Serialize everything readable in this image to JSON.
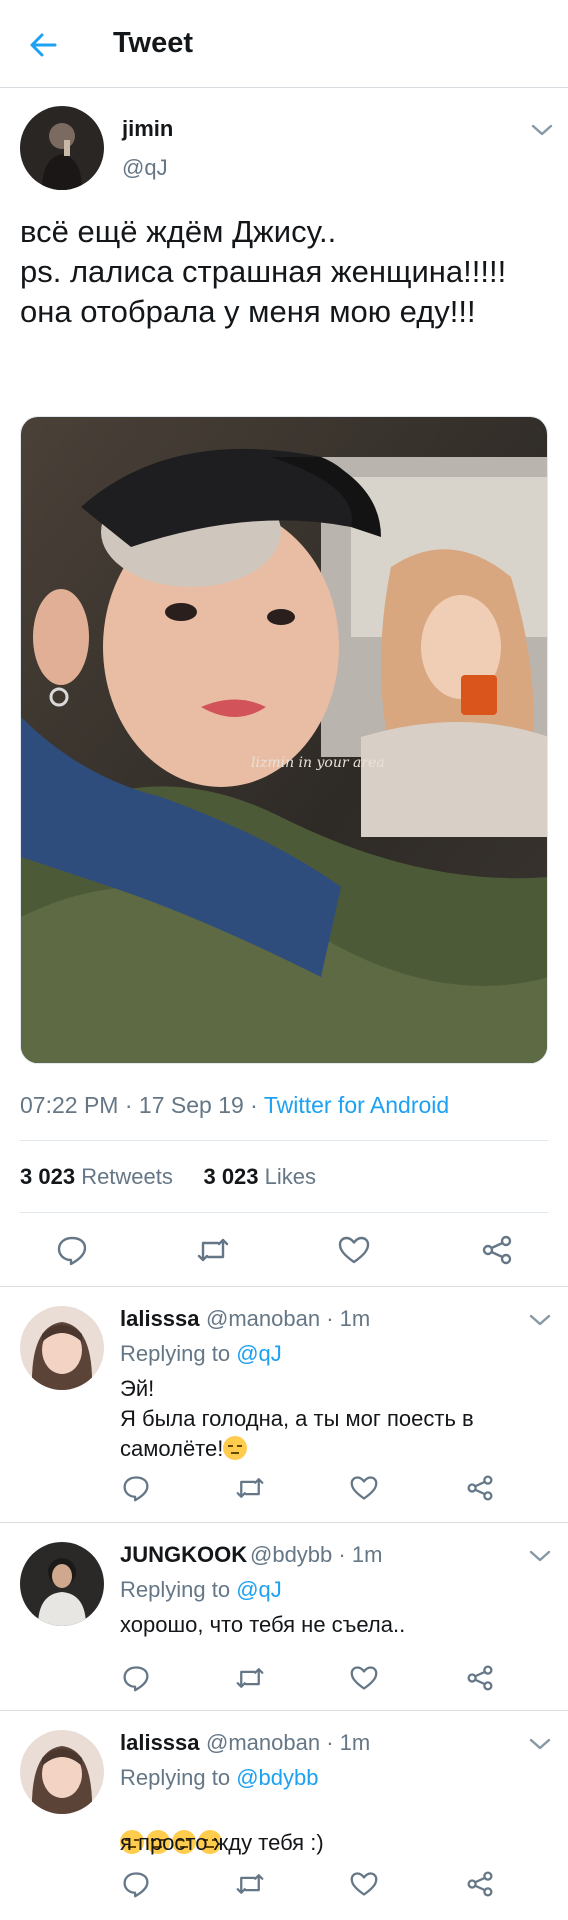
{
  "header": {
    "title": "Tweet"
  },
  "tweet": {
    "author_name": "jimin",
    "author_handle": "@qJ",
    "text": "всё ещё ждём Джису..\nps. лалиса страшная женщина!!!!!\nона отобрала у меня мою еду!!!",
    "photo_watermark": "lizmin in your area",
    "time": "07:22 PM",
    "date": "17 Sep 19",
    "separator": " · ",
    "client": "Twitter for Android",
    "retweets_count": "3 023",
    "retweets_label": "Retweets",
    "likes_count": "3 023",
    "likes_label": "Likes"
  },
  "replies": [
    {
      "name": "lalisssa",
      "handle": "@manoban",
      "time": "1m",
      "replying_label": "Replying to ",
      "replying_to": "@qJ",
      "text": "Эй!\nЯ была голодна, а ты мог поесть в самолёте!",
      "emoji": "unamused-face-emoji"
    },
    {
      "name": "JUNGKOOK",
      "handle": "@bdybb",
      "time": "1m",
      "replying_label": "Replying to ",
      "replying_to": "@qJ",
      "text": "хорошо, что тебя не съела.."
    },
    {
      "name": "lalisssa",
      "handle": "@manoban",
      "time": "1m",
      "replying_label": "Replying to ",
      "replying_to": "@bdybb",
      "text": "я просто жду тебя :)",
      "emoji": "unamused-face-emoji"
    }
  ],
  "icons": {
    "back": "arrow-left-icon",
    "more": "chevron-down-icon",
    "reply": "reply-icon",
    "retweet": "retweet-icon",
    "like": "heart-icon",
    "share": "share-icon"
  },
  "colors": {
    "accent": "#1da1f2",
    "secondary_text": "#657786",
    "primary_text": "#14171a",
    "divider": "#e1e8ed"
  }
}
